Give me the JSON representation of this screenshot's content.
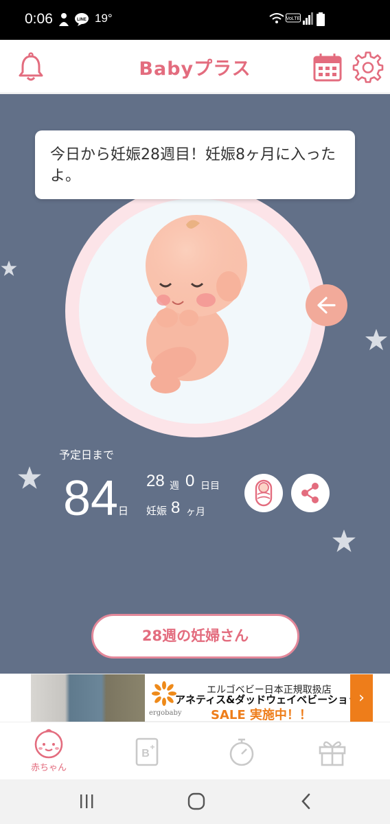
{
  "status_bar": {
    "time": "0:06",
    "temperature": "19°",
    "icons": [
      "buddy-icon",
      "line-icon",
      "wifi-icon",
      "volte-icon",
      "signal-icon",
      "battery-icon"
    ]
  },
  "header": {
    "app_title": "Babyプラス",
    "left_icon": "bell-icon",
    "right_icons": [
      "calendar-icon",
      "gear-icon"
    ]
  },
  "main": {
    "message": "今日から妊娠28週目！妊娠8ヶ月に入ったよ。",
    "countdown_label": "予定日まで",
    "days_remaining": "84",
    "days_unit": "日",
    "week_number": "28",
    "week_unit": "週",
    "day_number": "0",
    "day_unit": "日目",
    "pregnancy_label": "妊娠",
    "month_number": "8",
    "month_unit": "ヶ月",
    "cta_label": "28週の妊婦さん"
  },
  "ad": {
    "shop_label": "エルゴベビー日本正規取扱店",
    "headline": "アネティス&ダッドウェイベビーショップ",
    "sale_text": "SALE 実施中！！",
    "logo_text": "ergobaby",
    "arrow": "›"
  },
  "bottom_nav": {
    "tabs": [
      {
        "icon": "baby-face-icon",
        "label": "赤ちゃん",
        "active": true
      },
      {
        "icon": "book-plus-icon",
        "label": "",
        "active": false
      },
      {
        "icon": "stopwatch-icon",
        "label": "",
        "active": false
      },
      {
        "icon": "gift-icon",
        "label": "",
        "active": false
      }
    ]
  },
  "colors": {
    "accent": "#e36c7e",
    "background": "#627088",
    "peach": "#f2aa9a",
    "ad_orange": "#ee7d1a"
  }
}
